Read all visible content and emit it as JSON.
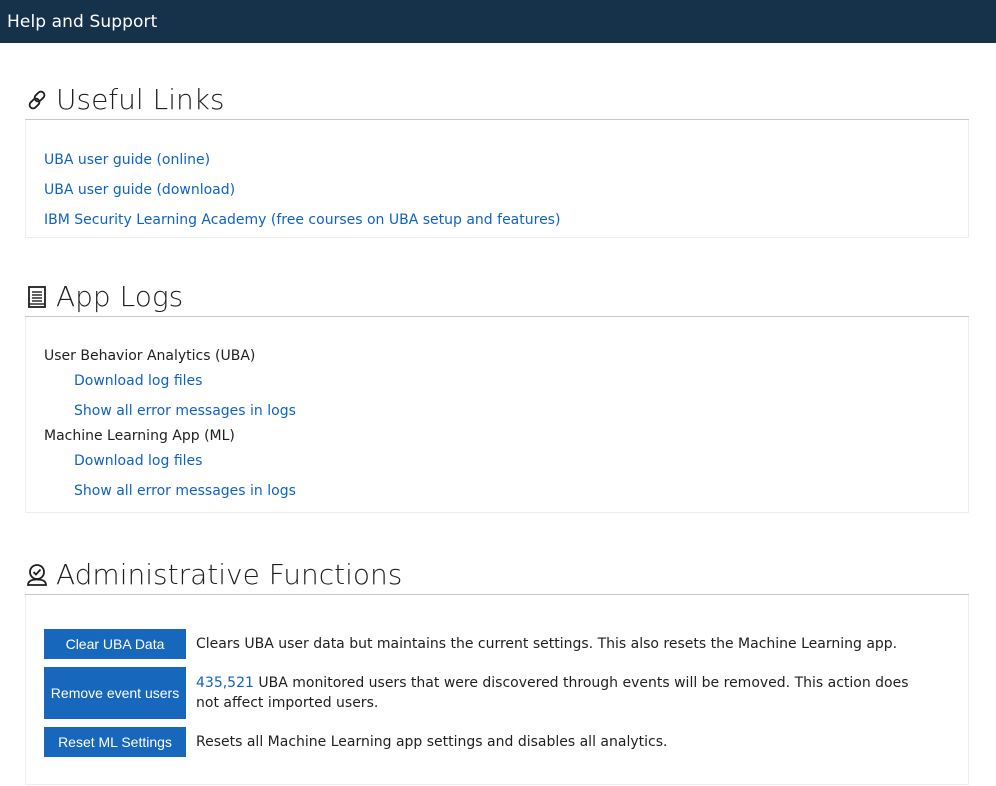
{
  "topbar": {
    "title": "Help and Support",
    "bg_color": "#15324a"
  },
  "useful_links": {
    "title": "Useful Links",
    "icon": "link-icon",
    "links": [
      {
        "label": "UBA user guide (online)"
      },
      {
        "label": "UBA user guide (download)"
      },
      {
        "label": "IBM Security Learning Academy (free courses on UBA setup and features)"
      }
    ]
  },
  "app_logs": {
    "title": "App Logs",
    "icon": "document-icon",
    "groups": [
      {
        "title": "User Behavior Analytics (UBA)",
        "download_label": "Download log files",
        "errors_label": "Show all error messages in logs"
      },
      {
        "title": "Machine Learning App (ML)",
        "download_label": "Download log files",
        "errors_label": "Show all error messages in logs"
      }
    ]
  },
  "admin": {
    "title": "Administrative Functions",
    "icon": "user-check-icon",
    "button_color": "#1767bd",
    "link_color": "#0f62c4",
    "actions": [
      {
        "button": "Clear UBA Data",
        "description": "Clears UBA user data but maintains the current settings. This also resets the Machine Learning app."
      },
      {
        "button": "Remove event users",
        "count": "435,521",
        "description": " UBA monitored users that were discovered through events will be removed. This action does not affect imported users."
      },
      {
        "button": "Reset ML Settings",
        "description": "Resets all Machine Learning app settings and disables all analytics."
      }
    ]
  }
}
